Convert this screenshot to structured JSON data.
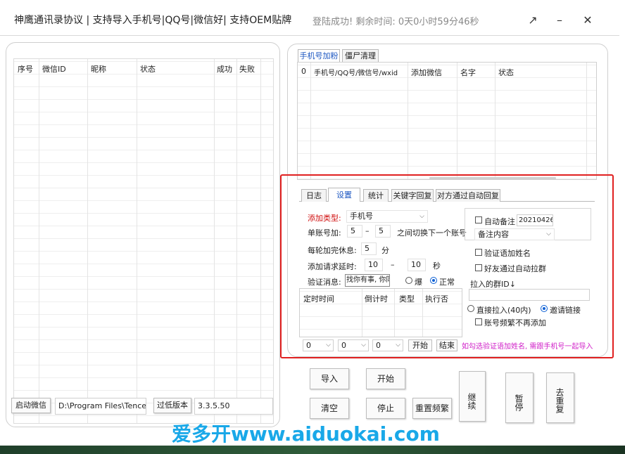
{
  "window": {
    "title": "神鹰通讯录协议  | 支持导入手机号|QQ号|微信好| 支持OEM贴牌",
    "status": "登陆成功!  剩余时间: 0天0小时59分46秒",
    "restore_glyph": "↗",
    "minimize_glyph": "–",
    "close_glyph": "✕"
  },
  "left_table": {
    "headers": [
      "序号",
      "微信ID",
      "昵称",
      "状态",
      "成功",
      "失败"
    ]
  },
  "left_bottom": {
    "start_wechat": "启动微信",
    "path": "D:\\Program Files\\Tencent",
    "low_version": "过低版本",
    "version": "3.3.5.50"
  },
  "top_tabs": [
    "手机号加粉",
    "僵尸清理"
  ],
  "right_table": {
    "headers": [
      "0",
      "手机号/QQ号/微信号/wxid",
      "添加微信",
      "名字",
      "状态"
    ]
  },
  "settings_tabs": [
    "日志",
    "设置",
    "统计",
    "关键字回复",
    "对方通过自动回复"
  ],
  "settings": {
    "add_type_label": "添加类型:",
    "add_type_value": "手机号",
    "per_account_label": "单账号加:",
    "per_min": "5",
    "dash": "–",
    "per_max": "5",
    "switch_text": "之间切换下一个账号",
    "rest_label": "每轮加完休息:",
    "rest_value": "5",
    "rest_unit": "分",
    "delay_label": "添加请求延时:",
    "delay_min": "10",
    "delay_max": "10",
    "delay_unit": "秒",
    "verify_label": "验证消息:",
    "verify_value": "找你有事, 你同",
    "mode_explode": "爆",
    "mode_normal": "正常",
    "sched_headers": [
      "定时时间",
      "倒计时",
      "类型",
      "执行否"
    ],
    "combo_a": "0",
    "combo_b": "0",
    "combo_c": "0",
    "start_btn": "开始",
    "end_btn": "结束",
    "hint": "如勾选验证语加姓名, 需跟手机号一起导入"
  },
  "right_options": {
    "auto_note": "自动备注",
    "note_date": "20210426",
    "note_content": "备注内容",
    "verify_name": "验证语加姓名",
    "auto_group": "好友通过自动拉群",
    "group_id_label": "拉入的群ID↓",
    "direct_pull": "直接拉入(40内)",
    "invite_link": "邀请链接",
    "freq_skip": "账号频繁不再添加"
  },
  "actions": {
    "import": "导入",
    "start": "开始",
    "clear": "清空",
    "stop": "停止",
    "reset_freq": "重置频繁",
    "continue": "继续",
    "pause": "暂停",
    "dedupe": "去重复"
  },
  "watermark": "爱多开www.aiduokai.com"
}
